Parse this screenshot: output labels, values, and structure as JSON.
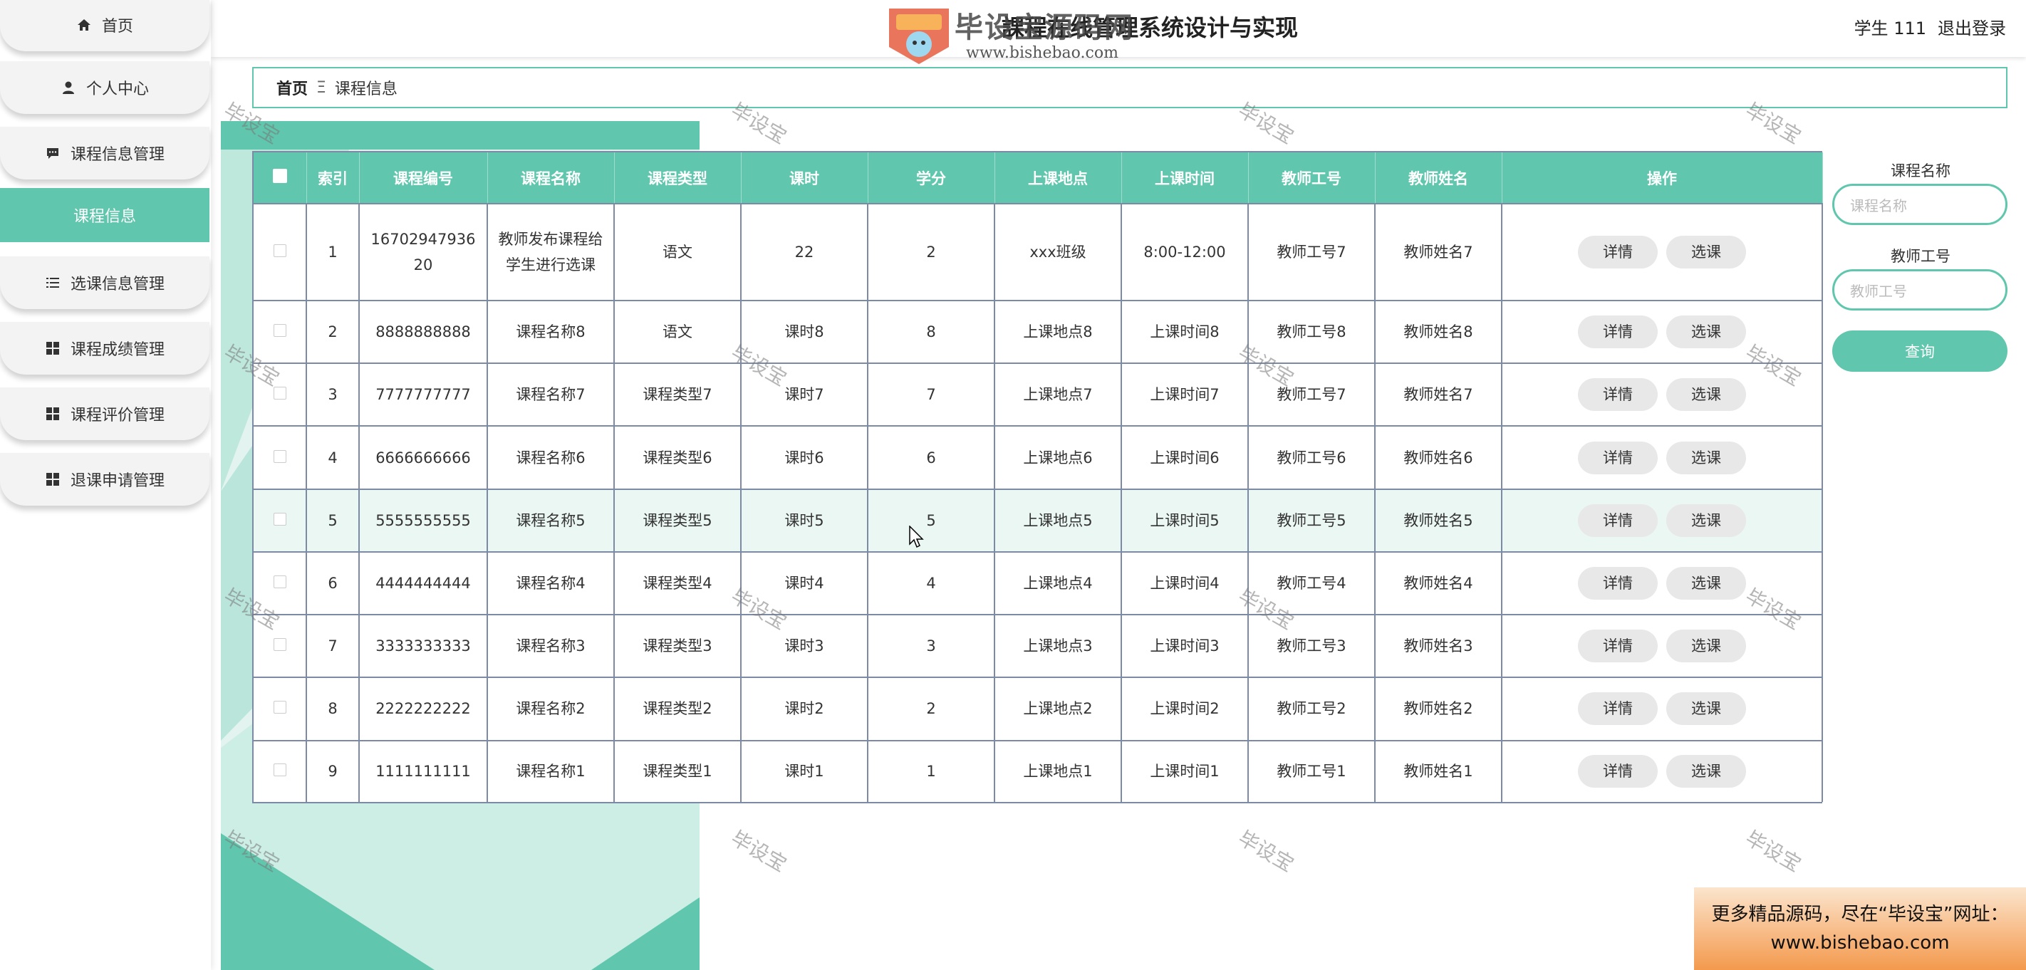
{
  "header": {
    "title": "課程在线管理系统设计与实现",
    "watermark_logo_text": "毕设宝源码网",
    "watermark_url": "www.bishebao.com",
    "user_label": "学生 111",
    "logout_label": "退出登录"
  },
  "sidebar": {
    "items": [
      {
        "label": "首页",
        "icon": "home-icon"
      },
      {
        "label": "个人中心",
        "icon": "user-icon"
      },
      {
        "label": "课程信息管理",
        "icon": "chat-icon"
      },
      {
        "label": "课程信息",
        "icon": "",
        "active": true
      },
      {
        "label": "选课信息管理",
        "icon": "list-icon"
      },
      {
        "label": "课程成绩管理",
        "icon": "grid-icon"
      },
      {
        "label": "课程评价管理",
        "icon": "grid-icon"
      },
      {
        "label": "退课申请管理",
        "icon": "grid-icon"
      }
    ]
  },
  "breadcrumb": {
    "home": "首页",
    "separator": "Ξ",
    "current": "课程信息"
  },
  "table": {
    "columns": [
      "索引",
      "课程编号",
      "课程名称",
      "课程类型",
      "课时",
      "学分",
      "上课地点",
      "上课时间",
      "教师工号",
      "教师姓名",
      "操作"
    ],
    "detail_label": "详情",
    "select_label": "选课",
    "rows": [
      [
        "1",
        "1670294793620",
        "教师发布课程给学生进行选课",
        "语文",
        "22",
        "2",
        "xxx班级",
        "8:00-12:00",
        "教师工号7",
        "教师姓名7"
      ],
      [
        "2",
        "8888888888",
        "课程名称8",
        "语文",
        "课时8",
        "8",
        "上课地点8",
        "上课时间8",
        "教师工号8",
        "教师姓名8"
      ],
      [
        "3",
        "7777777777",
        "课程名称7",
        "课程类型7",
        "课时7",
        "7",
        "上课地点7",
        "上课时间7",
        "教师工号7",
        "教师姓名7"
      ],
      [
        "4",
        "6666666666",
        "课程名称6",
        "课程类型6",
        "课时6",
        "6",
        "上课地点6",
        "上课时间6",
        "教师工号6",
        "教师姓名6"
      ],
      [
        "5",
        "5555555555",
        "课程名称5",
        "课程类型5",
        "课时5",
        "5",
        "上课地点5",
        "上课时间5",
        "教师工号5",
        "教师姓名5"
      ],
      [
        "6",
        "4444444444",
        "课程名称4",
        "课程类型4",
        "课时4",
        "4",
        "上课地点4",
        "上课时间4",
        "教师工号4",
        "教师姓名4"
      ],
      [
        "7",
        "3333333333",
        "课程名称3",
        "课程类型3",
        "课时3",
        "3",
        "上课地点3",
        "上课时间3",
        "教师工号3",
        "教师姓名3"
      ],
      [
        "8",
        "2222222222",
        "课程名称2",
        "课程类型2",
        "课时2",
        "2",
        "上课地点2",
        "上课时间2",
        "教师工号2",
        "教师姓名2"
      ],
      [
        "9",
        "1111111111",
        "课程名称1",
        "课程类型1",
        "课时1",
        "1",
        "上课地点1",
        "上课时间1",
        "教师工号1",
        "教师姓名1"
      ]
    ]
  },
  "search": {
    "course_name_label": "课程名称",
    "course_name_placeholder": "课程名称",
    "teacher_id_label": "教师工号",
    "teacher_id_placeholder": "教师工号",
    "query_label": "查询"
  },
  "watermark_text": "毕设宝",
  "ad": {
    "line1": "更多精品源码，尽在“毕设宝”网址：",
    "line2": "www.bishebao.com"
  },
  "colors": {
    "accent": "#60c6ad",
    "table_border": "#7d8aa6",
    "button_bg": "#e8e8e8"
  }
}
